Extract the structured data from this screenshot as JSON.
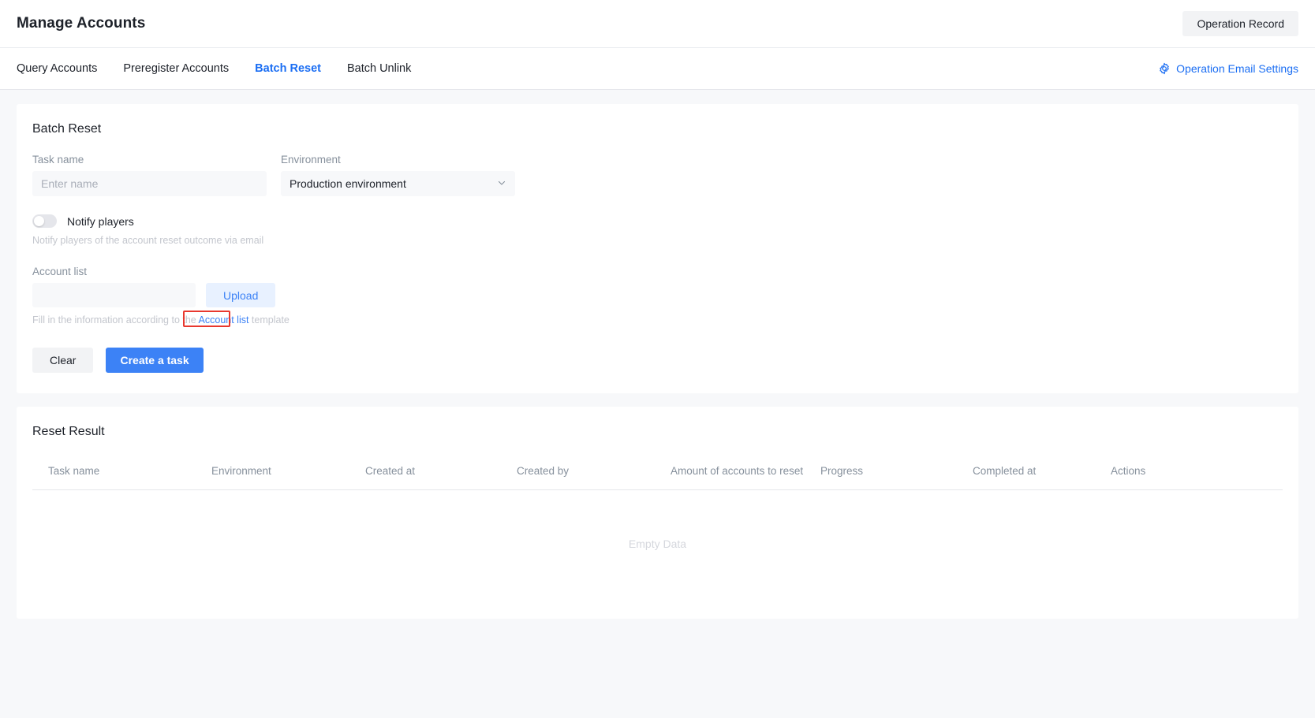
{
  "header": {
    "title": "Manage Accounts",
    "operation_record_label": "Operation Record"
  },
  "tabs": [
    {
      "label": "Query Accounts",
      "active": false
    },
    {
      "label": "Preregister Accounts",
      "active": false
    },
    {
      "label": "Batch Reset",
      "active": true
    },
    {
      "label": "Batch Unlink",
      "active": false
    }
  ],
  "email_settings": {
    "label": "Operation Email Settings",
    "icon": "gear-icon"
  },
  "batch_reset": {
    "card_title": "Batch Reset",
    "task_name": {
      "label": "Task name",
      "value": "",
      "placeholder": "Enter name"
    },
    "environment": {
      "label": "Environment",
      "selected": "Production environment",
      "icon": "chevron-down-icon"
    },
    "notify": {
      "label": "Notify players",
      "state": "off",
      "help": "Notify players of the account reset outcome via email"
    },
    "account_list": {
      "label": "Account list",
      "file_value": "",
      "upload_label": "Upload",
      "hint_prefix": "Fill in the information according to the ",
      "hint_link": "Account list",
      "hint_suffix": " template"
    },
    "buttons": {
      "clear": "Clear",
      "create": "Create a task"
    }
  },
  "reset_result": {
    "card_title": "Reset Result",
    "columns": [
      "Task name",
      "Environment",
      "Created at",
      "Created by",
      "Amount of accounts to reset",
      "Progress",
      "Completed at",
      "Actions"
    ],
    "rows": [],
    "empty_text": "Empty Data"
  },
  "annotation": {
    "color": "#e8382e",
    "target": "Account list"
  },
  "colors": {
    "accent": "#3c82f6",
    "tab_active": "#1b6ef3",
    "muted": "#86909c",
    "panel": "#ffffff",
    "page_bg": "#f7f8fa",
    "annotation": "#e8382e"
  }
}
